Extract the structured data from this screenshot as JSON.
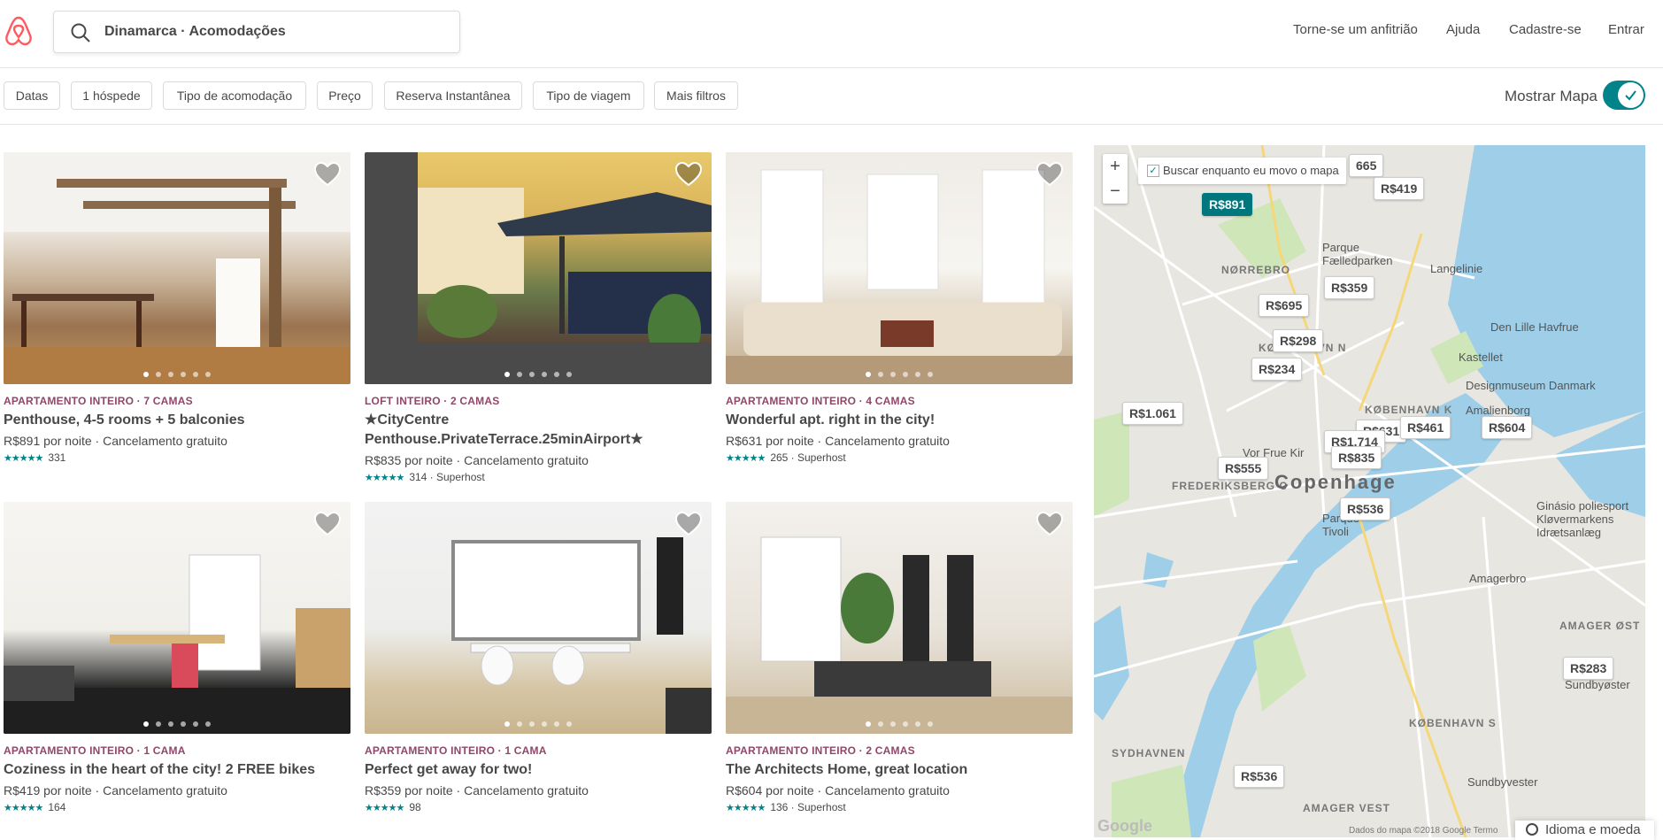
{
  "header": {
    "search_text": "Dinamarca · Acomodações",
    "nav": [
      "Torne-se um anfitrião",
      "Ajuda",
      "Cadastre-se",
      "Entrar"
    ]
  },
  "filters": {
    "pills": [
      "Datas",
      "1 hóspede",
      "Tipo de acomodação",
      "Preço",
      "Reserva Instantânea",
      "Tipo de viagem",
      "Mais filtros"
    ],
    "show_map_label": "Mostrar Mapa",
    "show_map_on": true
  },
  "listings": [
    {
      "kicker": "APARTAMENTO INTEIRO · 7 CAMAS",
      "title": "Penthouse, 4-5 rooms + 5 balconies",
      "price": "R$891",
      "price_suffix": " por noite · Cancelamento gratuito",
      "stars": "★★★★★",
      "reviews": "331"
    },
    {
      "kicker": "LOFT INTEIRO · 2 CAMAS",
      "title": "★CityCentre Penthouse.PrivateTerrace.25minAirport★",
      "price": "R$835",
      "price_suffix": " por noite · Cancelamento gratuito",
      "stars": "★★★★★",
      "reviews": "314 · Superhost"
    },
    {
      "kicker": "APARTAMENTO INTEIRO · 4 CAMAS",
      "title": "Wonderful apt. right in the city!",
      "price": "R$631",
      "price_suffix": " por noite · Cancelamento gratuito",
      "stars": "★★★★★",
      "reviews": "265 · Superhost"
    },
    {
      "kicker": "APARTAMENTO INTEIRO · 1 CAMA",
      "title": "Coziness in the heart of the city! 2 FREE bikes",
      "price": "R$419",
      "price_suffix": " por noite · Cancelamento gratuito",
      "stars": "★★★★★",
      "reviews": "164"
    },
    {
      "kicker": "APARTAMENTO INTEIRO · 1 CAMA",
      "title": "Perfect get away for two!",
      "price": "R$359",
      "price_suffix": " por noite · Cancelamento gratuito",
      "stars": "★★★★★",
      "reviews": "98"
    },
    {
      "kicker": "APARTAMENTO INTEIRO · 2 CAMAS",
      "title": "The Architects Home, great location",
      "price": "R$604",
      "price_suffix": " por noite · Cancelamento gratuito",
      "stars": "★★★★★",
      "reviews": "136 · Superhost"
    }
  ],
  "map": {
    "search_as_move": "Buscar enquanto eu movo o mapa",
    "zoom_in": "+",
    "zoom_out": "−",
    "pins": [
      "665",
      "R$419",
      "R$891",
      "R$359",
      "R$695",
      "R$298",
      "R$234",
      "R$1.061",
      "R$631",
      "R$461",
      "R$604",
      "R$1.714",
      "R$835",
      "R$555",
      "R$536",
      "R$283",
      "R$536"
    ],
    "labels": {
      "city": "Copenhage",
      "norrebro": "NØRREBRO",
      "parque": "Parque Fælledparken",
      "langelinie": "Langelinie",
      "havfrue": "Den Lille Havfrue",
      "kastellet": "Kastellet",
      "design": "Designmuseum Danmark",
      "amalienborg": "Amalienborg",
      "kbh_n": "KØBENHAVN N",
      "kbh_k": "KØBENHAVN K",
      "frederiksberg": "FREDERIKSBERG C",
      "vor_frue": "Vor Frue Kir",
      "tivoli": "Parque Tivoli",
      "ginasio": "Ginásio poliesport Kløvermarkens Idrætsanlæg",
      "amagerbro": "Amagerbro",
      "amager_ost": "AMAGER ØST",
      "sundbyoster": "Sundbyøster",
      "kbh_s": "KØBENHAVN S",
      "sundbyvester": "Sundbyvester",
      "sydhavnen": "SYDHAVNEN",
      "amager_vest": "AMAGER VEST"
    },
    "attribution": "Dados do mapa ©2018 Google   Termo",
    "google": "Google"
  },
  "footer": {
    "language": "Idioma e moeda"
  },
  "colors": {
    "brand": "#FF5A5F",
    "teal": "#008489",
    "kicker": "#914669"
  }
}
